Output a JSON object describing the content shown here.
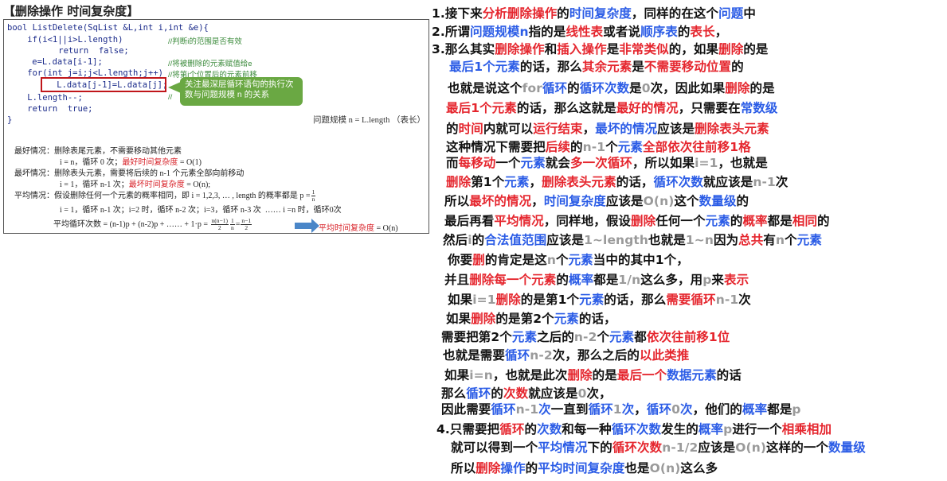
{
  "title": "【删除操作 时间复杂度】",
  "code": {
    "lines": [
      "bool ListDelete(SqList &L,int i,int &e){",
      "    if(i<1||i>L.length)",
      "       return  false;",
      "    e=L.data[i-1];",
      "    for(int j=i;j<L.length;j++)",
      "       L.data[j-1]=L.data[j];",
      "    L.length--;",
      "    return  true;",
      "}"
    ],
    "comments": [
      "//判断i的范围是否有效",
      "//将被删除的元素赋值给e",
      "//将第i个位置后的元素前移",
      "//"
    ],
    "callout": "关注最深层循环语句的执行次数与问题规模 n 的关系",
    "aside": "问题规模 n = L.length （表长）"
  },
  "analysis": {
    "best_label": "最好情况：删除表尾元素，不需要移动其他元素",
    "best_detail_prefix": "i = n，循环 0 次；",
    "best_detail_red": "最好时间复杂度",
    "best_detail_suffix": " = O(1)",
    "worst_label": "最坏情况：删除表头元素，需要将后续的 n-1 个元素全部向前移动",
    "worst_detail_prefix": "i = 1，循环 n-1 次；",
    "worst_detail_red": "最坏时间复杂度",
    "worst_detail_suffix": " = O(n);",
    "avg_label": "平均情况：假设删除任何一个元素的概率相同，即 i = 1,2,3, … , length 的概率都是 p =",
    "avg_frac_top": "1",
    "avg_frac_bot": "n",
    "avg_detail": "i = 1，循环 n-1 次；i=2 时，循环 n-2 次；i=3，循环 n-3 次  …… i =n 时，循环0次",
    "avg_formula_prefix": "平均循环次数 = (n-1)p + (n-2)p + …… + 1·p =",
    "frac1_top": "n(n−1)",
    "frac1_bot": "2",
    "frac2_top": "1",
    "frac2_bot": "n",
    "eq": "=",
    "frac3_top": "n−1",
    "frac3_bot": "2",
    "avg_result_red": "平均时间复杂度",
    "avg_result_suffix": " = O(n)"
  },
  "notes": [
    [
      [
        "k",
        "1.接下来"
      ],
      [
        "r",
        "分析删除操作"
      ],
      [
        "k",
        "的"
      ],
      [
        "b",
        "时间复杂度"
      ],
      [
        "k",
        "，同样的在这个"
      ],
      [
        "b",
        "问题"
      ],
      [
        "k",
        "中"
      ]
    ],
    [
      [
        "k",
        "2.所谓"
      ],
      [
        "b",
        "问题规模"
      ],
      [
        "b",
        "n"
      ],
      [
        "k",
        "指的是"
      ],
      [
        "r",
        "线性表"
      ],
      [
        "k",
        "或者说"
      ],
      [
        "b",
        "顺序表"
      ],
      [
        "k",
        "的"
      ],
      [
        "r",
        "表长"
      ],
      [
        "k",
        "，"
      ]
    ],
    [
      [
        "k",
        "3.那么其实"
      ],
      [
        "r",
        "删除操作"
      ],
      [
        "k",
        "和"
      ],
      [
        "r",
        "插入操作"
      ],
      [
        "k",
        "是"
      ],
      [
        "r",
        "非常类似"
      ],
      [
        "k",
        "的，如果"
      ],
      [
        "r",
        "删除"
      ],
      [
        "k",
        "的是"
      ]
    ],
    [
      [
        "b",
        "最后1个元素"
      ],
      [
        "k",
        "的话，那么"
      ],
      [
        "r",
        "其余元素"
      ],
      [
        "k",
        "是"
      ],
      [
        "r",
        "不需要移动位置"
      ],
      [
        "k",
        "的"
      ]
    ],
    [
      [
        "k",
        "也就是说这个"
      ],
      [
        "g",
        "for"
      ],
      [
        "b",
        "循环"
      ],
      [
        "k",
        "的"
      ],
      [
        "b",
        "循环次数"
      ],
      [
        "k",
        "是"
      ],
      [
        "g",
        "0"
      ],
      [
        "k",
        "次，因此如果"
      ],
      [
        "r",
        "删除"
      ],
      [
        "k",
        "的是"
      ]
    ],
    [
      [
        "r",
        "最后1个元素"
      ],
      [
        "k",
        "的话，那么这就是"
      ],
      [
        "r",
        "最好的情况"
      ],
      [
        "k",
        "，只需要在"
      ],
      [
        "b",
        "常数级"
      ]
    ],
    [
      [
        "k",
        "的"
      ],
      [
        "r",
        "时间"
      ],
      [
        "k",
        "内就可以"
      ],
      [
        "r",
        "运行结束"
      ],
      [
        "k",
        "，"
      ],
      [
        "b",
        "最坏的情况"
      ],
      [
        "k",
        "应该是"
      ],
      [
        "r",
        "删除表头元素"
      ]
    ],
    [
      [
        "k",
        "这种情况下需要把"
      ],
      [
        "r",
        "后续"
      ],
      [
        "k",
        "的"
      ],
      [
        "g",
        "n-1"
      ],
      [
        "k",
        "个"
      ],
      [
        "b",
        "元素"
      ],
      [
        "r",
        "全部依次往前移1格"
      ]
    ],
    [
      [
        "k",
        "而"
      ],
      [
        "r",
        "每移动"
      ],
      [
        "k",
        "一个"
      ],
      [
        "b",
        "元素"
      ],
      [
        "k",
        "就会"
      ],
      [
        "r",
        "多一次循环"
      ],
      [
        "k",
        "，所以如果"
      ],
      [
        "g",
        "i=1"
      ],
      [
        "k",
        "，也就是"
      ]
    ],
    [
      [
        "r",
        "删除"
      ],
      [
        "k",
        "第1个"
      ],
      [
        "b",
        "元素"
      ],
      [
        "k",
        "，"
      ],
      [
        "r",
        "删除表头元素"
      ],
      [
        "k",
        "的话，"
      ],
      [
        "b",
        "循环次数"
      ],
      [
        "k",
        "就应该是"
      ],
      [
        "g",
        "n-1"
      ],
      [
        "k",
        "次"
      ]
    ],
    [
      [
        "k",
        "所以"
      ],
      [
        "r",
        "最坏的情况"
      ],
      [
        "k",
        "，"
      ],
      [
        "b",
        "时间复杂度"
      ],
      [
        "k",
        "应该是"
      ],
      [
        "g",
        "O(n)"
      ],
      [
        "k",
        "这个"
      ],
      [
        "b",
        "数量级"
      ],
      [
        "k",
        "的"
      ]
    ],
    [
      [
        "k",
        "最后再看"
      ],
      [
        "r",
        "平均情况"
      ],
      [
        "k",
        "，同样地，假设"
      ],
      [
        "r",
        "删除"
      ],
      [
        "k",
        "任何一个"
      ],
      [
        "b",
        "元素"
      ],
      [
        "k",
        "的"
      ],
      [
        "r",
        "概率"
      ],
      [
        "k",
        "都是"
      ],
      [
        "r",
        "相同"
      ],
      [
        "k",
        "的"
      ]
    ],
    [
      [
        "k",
        "然后"
      ],
      [
        "g",
        "i"
      ],
      [
        "k",
        "的"
      ],
      [
        "b",
        "合法值范围"
      ],
      [
        "k",
        "应该是"
      ],
      [
        "g",
        "1~length"
      ],
      [
        "k",
        "也就是"
      ],
      [
        "g",
        "1~n"
      ],
      [
        "k",
        "因为"
      ],
      [
        "r",
        "总共"
      ],
      [
        "k",
        "有"
      ],
      [
        "g",
        "n"
      ],
      [
        "k",
        "个"
      ],
      [
        "b",
        "元素"
      ]
    ],
    [
      [
        "k",
        "你要"
      ],
      [
        "r",
        "删"
      ],
      [
        "k",
        "的肯定是这"
      ],
      [
        "g",
        "n"
      ],
      [
        "k",
        "个"
      ],
      [
        "b",
        "元素"
      ],
      [
        "k",
        "当中的其中1个，"
      ]
    ],
    [
      [
        "k",
        "并且"
      ],
      [
        "r",
        "删除每一个元素"
      ],
      [
        "k",
        "的"
      ],
      [
        "b",
        "概率"
      ],
      [
        "k",
        "都是"
      ],
      [
        "g",
        "1/n"
      ],
      [
        "k",
        "这么多，用"
      ],
      [
        "g",
        "p"
      ],
      [
        "k",
        "来"
      ],
      [
        "r",
        "表示"
      ]
    ],
    [
      [
        "k",
        "如果"
      ],
      [
        "g",
        "i=1"
      ],
      [
        "r",
        "删除"
      ],
      [
        "k",
        "的是第1个"
      ],
      [
        "b",
        "元素"
      ],
      [
        "k",
        "的话，那么"
      ],
      [
        "r",
        "需要循环"
      ],
      [
        "g",
        "n-1"
      ],
      [
        "k",
        "次"
      ]
    ],
    [
      [
        "k",
        "如果"
      ],
      [
        "r",
        "删除"
      ],
      [
        "k",
        "的是第2个"
      ],
      [
        "b",
        "元素"
      ],
      [
        "k",
        "的话，"
      ]
    ],
    [
      [
        "k",
        "需要把第2个"
      ],
      [
        "b",
        "元素"
      ],
      [
        "k",
        "之后的"
      ],
      [
        "g",
        "n-2"
      ],
      [
        "k",
        "个"
      ],
      [
        "b",
        "元素"
      ],
      [
        "k",
        "都"
      ],
      [
        "r",
        "依次往前移1位"
      ]
    ],
    [
      [
        "k",
        "也就是需要"
      ],
      [
        "b",
        "循环"
      ],
      [
        "g",
        "n-2"
      ],
      [
        "k",
        "次，那么之后的"
      ],
      [
        "r",
        "以此类推"
      ]
    ],
    [
      [
        "k",
        "如果"
      ],
      [
        "g",
        "i=n"
      ],
      [
        "k",
        "，也就是此次"
      ],
      [
        "r",
        "删除"
      ],
      [
        "k",
        "的是"
      ],
      [
        "r",
        "最后一个"
      ],
      [
        "b",
        "数据元素"
      ],
      [
        "k",
        "的话"
      ]
    ],
    [
      [
        "k",
        "那么"
      ],
      [
        "b",
        "循环"
      ],
      [
        "k",
        "的"
      ],
      [
        "r",
        "次数"
      ],
      [
        "k",
        "就应该是"
      ],
      [
        "g",
        "0"
      ],
      [
        "k",
        "次，"
      ]
    ],
    [
      [
        "k",
        "因此需要"
      ],
      [
        "b",
        "循环"
      ],
      [
        "g",
        "n-1"
      ],
      [
        "b",
        "次"
      ],
      [
        "k",
        "一直到"
      ],
      [
        "b",
        "循环"
      ],
      [
        "g",
        "1"
      ],
      [
        "b",
        "次"
      ],
      [
        "k",
        "，"
      ],
      [
        "b",
        "循环"
      ],
      [
        "g",
        "0"
      ],
      [
        "b",
        "次"
      ],
      [
        "k",
        "，他们的"
      ],
      [
        "b",
        "概率"
      ],
      [
        "k",
        "都是"
      ],
      [
        "g",
        "p"
      ]
    ],
    [
      [
        "k",
        "4.只需要把"
      ],
      [
        "r",
        "循环"
      ],
      [
        "k",
        "的"
      ],
      [
        "b",
        "次数"
      ],
      [
        "k",
        "和每一种"
      ],
      [
        "b",
        "循环次数"
      ],
      [
        "k",
        "发生的"
      ],
      [
        "b",
        "概率"
      ],
      [
        "g",
        "p"
      ],
      [
        "k",
        "进行一个"
      ],
      [
        "r",
        "相乘相加"
      ]
    ],
    [
      [
        "k",
        "就可以得到一个"
      ],
      [
        "b",
        "平均情况"
      ],
      [
        "k",
        "下的"
      ],
      [
        "r",
        "循环次数"
      ],
      [
        "g",
        "n-1/2"
      ],
      [
        "k",
        "应该是"
      ],
      [
        "g",
        "O(n)"
      ],
      [
        "k",
        "这样的一个"
      ],
      [
        "b",
        "数量级"
      ]
    ],
    [
      [
        "k",
        "所以"
      ],
      [
        "r",
        "删除"
      ],
      [
        "b",
        "操作"
      ],
      [
        "k",
        "的"
      ],
      [
        "b",
        "平均时间复杂度"
      ],
      [
        "k",
        "也是"
      ],
      [
        "g",
        "O(n)"
      ],
      [
        "k",
        "这么多"
      ]
    ]
  ]
}
